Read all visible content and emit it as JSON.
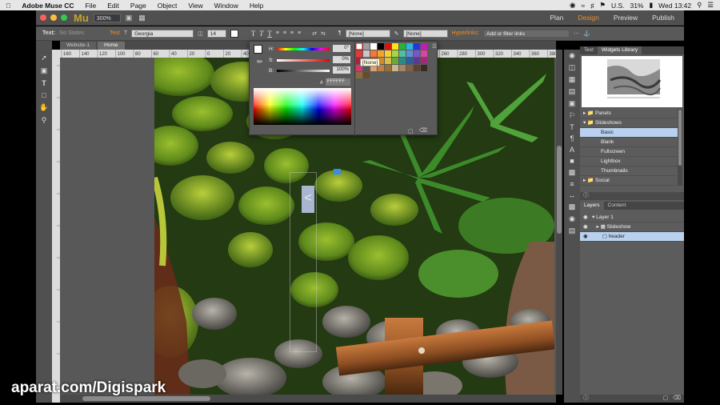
{
  "menubar": {
    "app": "Adobe Muse CC",
    "items": [
      "File",
      "Edit",
      "Page",
      "Object",
      "View",
      "Window",
      "Help"
    ],
    "locale": "U.S.",
    "battery": "31%",
    "clock": "Wed 13:42"
  },
  "appbar": {
    "logo": "Mu",
    "zoom": "300%",
    "modes": [
      "Plan",
      "Design",
      "Preview",
      "Publish"
    ]
  },
  "control": {
    "text_label": "Text:",
    "states": "No States",
    "text_btn": "Text",
    "font": "Georgia",
    "size": "14",
    "paragraph_style": "[None]",
    "character_style": "[None]",
    "hyperlinks_label": "Hyperlinks:",
    "hyperlinks_placeholder": "Add or filter links"
  },
  "tabs": [
    "Website-1",
    "Home"
  ],
  "ruler": [
    "160",
    "140",
    "120",
    "100",
    "80",
    "60",
    "40",
    "20",
    "0",
    "20",
    "40",
    "60",
    "80",
    "100",
    "120",
    "140",
    "160",
    "180",
    "200",
    "220",
    "240",
    "260",
    "280",
    "300",
    "320",
    "340",
    "360",
    "380"
  ],
  "picker": {
    "h_label": "H:",
    "s_label": "S:",
    "b_label": "B:",
    "h_value": "0°",
    "s_value": "0%",
    "b_value": "100%",
    "hash": "#",
    "hex": "FFFFFF",
    "none_tooltip": "[None]"
  },
  "slideshow": {
    "prev": "<"
  },
  "right_panel": {
    "tabs": [
      "Text",
      "Widgets Library"
    ],
    "tree": [
      {
        "label": "Panels",
        "kind": "folder"
      },
      {
        "label": "Slideshows",
        "kind": "folder-open"
      },
      {
        "label": "Basic",
        "kind": "item",
        "selected": true
      },
      {
        "label": "Blank",
        "kind": "item"
      },
      {
        "label": "Fullscreen",
        "kind": "item"
      },
      {
        "label": "Lightbox",
        "kind": "item"
      },
      {
        "label": "Thumbnails",
        "kind": "item"
      },
      {
        "label": "Social",
        "kind": "folder"
      }
    ],
    "layer_tabs": [
      "Layers",
      "Content"
    ],
    "layers": [
      {
        "label": "Layer 1"
      },
      {
        "label": "Slideshow"
      },
      {
        "label": "header",
        "selected": true
      }
    ]
  },
  "watermark": "aparat.com/Digispark"
}
